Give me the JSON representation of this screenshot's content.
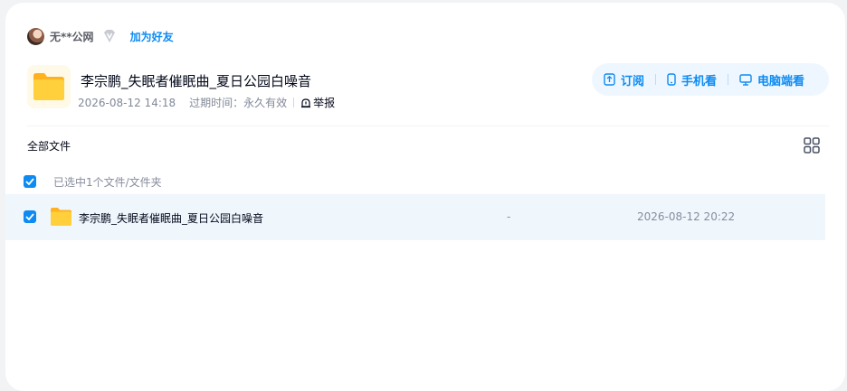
{
  "sharer": {
    "name": "无**公网",
    "add_friend": "加为好友"
  },
  "share": {
    "title": "李宗鹏_失眠者催眠曲_夏日公园白噪音",
    "created": "2026-08-12 14:18",
    "expire_label": "过期时间：",
    "expire_value": "永久有效",
    "report": "举报"
  },
  "actions": {
    "subscribe": "订阅",
    "mobile": "手机看",
    "desktop": "电脑端看"
  },
  "breadcrumb": {
    "root": "全部文件"
  },
  "selection": {
    "status": "已选中1个文件/文件夹"
  },
  "files": [
    {
      "name": "李宗鹏_失眠者催眠曲_夏日公园白噪音",
      "size": "-",
      "date": "2026-08-12 20:22",
      "selected": true
    }
  ],
  "colors": {
    "accent": "#0d8bf2",
    "row_highlight": "#eff7fd",
    "folder": "#ffc933"
  },
  "icons": [
    "avatar",
    "vip-diamond-icon",
    "folder-icon",
    "report-icon",
    "subscribe-icon",
    "phone-icon",
    "monitor-icon",
    "grid-view-icon",
    "checkbox-checked-icon"
  ]
}
